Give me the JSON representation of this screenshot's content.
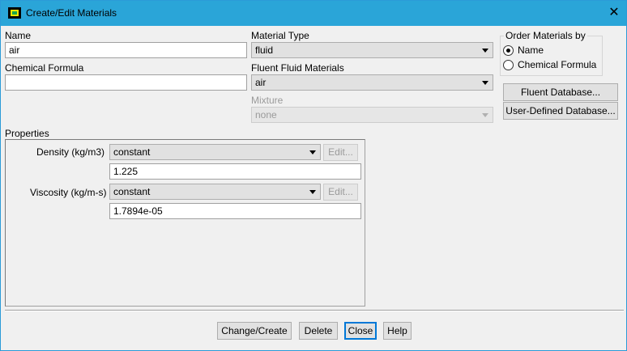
{
  "window": {
    "title": "Create/Edit Materials",
    "close_glyph": "✕"
  },
  "name": {
    "label": "Name",
    "value": "air"
  },
  "chemical_formula": {
    "label": "Chemical Formula",
    "value": ""
  },
  "material_type": {
    "label": "Material Type",
    "value": "fluid"
  },
  "fluent_fluid_materials": {
    "label": "Fluent Fluid Materials",
    "value": "air"
  },
  "mixture": {
    "label": "Mixture",
    "value": "none",
    "enabled": false
  },
  "order_by": {
    "title": "Order Materials by",
    "options": [
      {
        "label": "Name",
        "selected": true
      },
      {
        "label": "Chemical Formula",
        "selected": false
      }
    ]
  },
  "database_buttons": {
    "fluent": "Fluent Database...",
    "user_defined": "User-Defined Database..."
  },
  "properties": {
    "label": "Properties",
    "items": [
      {
        "label": "Density (kg/m3)",
        "method": "constant",
        "edit_label": "Edit...",
        "value": "1.225"
      },
      {
        "label": "Viscosity (kg/m-s)",
        "method": "constant",
        "edit_label": "Edit...",
        "value": "1.7894e-05"
      }
    ]
  },
  "footer": {
    "change_create": "Change/Create",
    "delete": "Delete",
    "close": "Close",
    "help": "Help"
  },
  "icons": {
    "app": "fluent-app-icon",
    "close": "close-icon",
    "dropdown": "chevron-down-icon"
  },
  "colors": {
    "titlebar": "#2aa5d8",
    "focus_border": "#0078d7",
    "background": "#f0f0f0"
  }
}
